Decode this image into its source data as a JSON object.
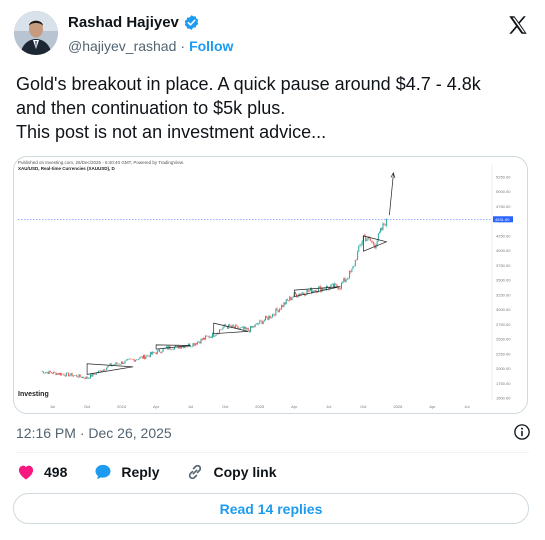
{
  "author": {
    "name": "Rashad Hajiyev",
    "handle": "@hajiyev_rashad",
    "separator": "·",
    "follow_label": "Follow",
    "verified": true
  },
  "tweet": {
    "lines": [
      "Gold's breakout in place. A quick pause around $4.7 - 4.8k",
      "and then continuation to $5k plus.",
      "This post is not an investment advice..."
    ]
  },
  "chart": {
    "header_line1": "Published on Investing.com, 26/Dec/2025 - 6:40:40 GMT, Powered by TradingView.",
    "header_line2": "XAU/USD, Real-time Currencies (XAUUSD), D",
    "logo_text": "Investing",
    "x_ticks": [
      "Jul",
      "Oct",
      "2024",
      "Apr",
      "Jul",
      "Oct",
      "2025",
      "Apr",
      "Jul",
      "Oct",
      "2026",
      "Apr",
      "Jul"
    ],
    "y_ticks": [
      "5250.00",
      "5000.00",
      "4750.00",
      "4500.00",
      "4250.00",
      "4000.00",
      "3750.00",
      "3500.00",
      "3250.00",
      "3000.00",
      "2750.00",
      "2500.00",
      "2250.00",
      "2000.00",
      "1750.00",
      "1500.00"
    ],
    "last_price_label": "4531.50"
  },
  "chart_data": {
    "type": "line",
    "title": "XAU/USD, Real-time Currencies (XAUUSD), D",
    "x": [
      "2023-06",
      "2023-09",
      "2023-10",
      "2023-12",
      "2024-03",
      "2024-05",
      "2024-07",
      "2024-09",
      "2024-10",
      "2024-12",
      "2025-02",
      "2025-04",
      "2025-06",
      "2025-08",
      "2025-09",
      "2025-10",
      "2025-11",
      "2025-12"
    ],
    "series": [
      {
        "values": [
          1950,
          1880,
          1840,
          2050,
          2200,
          2350,
          2400,
          2580,
          2720,
          2650,
          2900,
          3250,
          3350,
          3400,
          3650,
          4250,
          4100,
          4531.5
        ]
      }
    ],
    "ylim": [
      1500,
      5350
    ],
    "grid": false
  },
  "footer": {
    "time": "12:16 PM",
    "dot": "·",
    "date": "Dec 26, 2025",
    "likes": "498",
    "reply_label": "Reply",
    "copy_label": "Copy link",
    "read_label": "Read 14 replies"
  },
  "colors": {
    "accent": "#1d9bf0",
    "like": "#f91880",
    "candle_up": "#26a69a",
    "candle_down": "#ef5350"
  }
}
